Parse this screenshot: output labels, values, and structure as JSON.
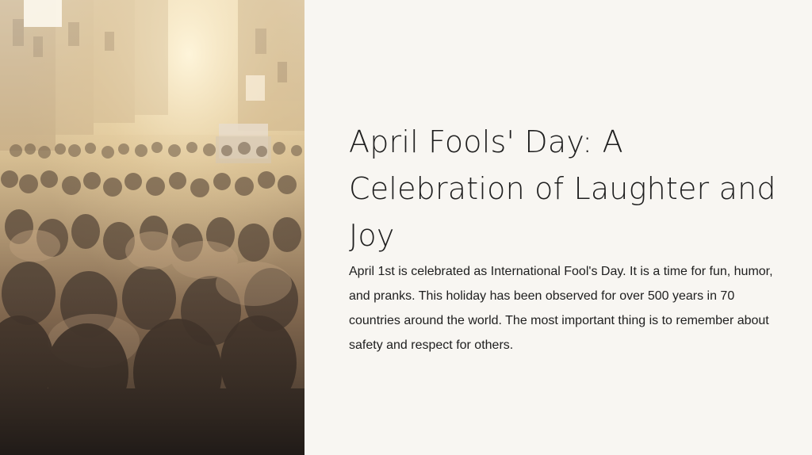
{
  "slide": {
    "title": "April Fools' Day: A Celebration of Laughter and Joy",
    "body": "April 1st is celebrated as International Fool's Day. It is a time for fun, humor, and pranks. This holiday has been observed for over 500 years in 70 countries around the world. The most important thing is to remember about safety and respect for others."
  },
  "colors": {
    "background": "#f8f6f2",
    "title_text": "#1f1f1f",
    "body_text": "#202020",
    "photo_warm_light": "#f3e7c8"
  }
}
